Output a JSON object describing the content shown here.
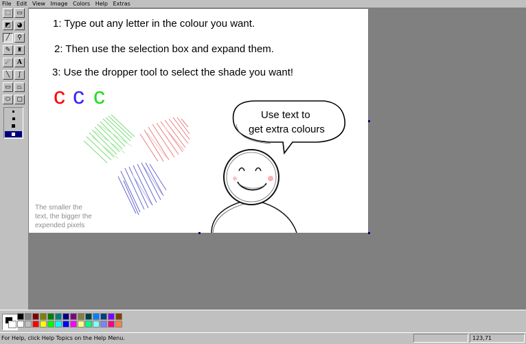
{
  "menu": [
    "File",
    "Edit",
    "View",
    "Image",
    "Colors",
    "Help",
    "Extras"
  ],
  "menu_accel": [
    "F",
    "E",
    "V",
    "I",
    "C",
    "H",
    "x"
  ],
  "tools": [
    {
      "name": "free-select-tool",
      "glyph": "⬚"
    },
    {
      "name": "select-tool",
      "glyph": "▭"
    },
    {
      "name": "eraser-tool",
      "glyph": "◩"
    },
    {
      "name": "fill-tool",
      "glyph": "◕"
    },
    {
      "name": "color-picker-tool",
      "glyph": "╱"
    },
    {
      "name": "magnifier-tool",
      "glyph": "⚲"
    },
    {
      "name": "pencil-tool",
      "glyph": "✎"
    },
    {
      "name": "brush-tool",
      "glyph": "♜"
    },
    {
      "name": "airbrush-tool",
      "glyph": "☄"
    },
    {
      "name": "text-tool",
      "glyph": "A"
    },
    {
      "name": "line-tool",
      "glyph": "╲"
    },
    {
      "name": "curve-tool",
      "glyph": "∫"
    },
    {
      "name": "rectangle-tool",
      "glyph": "▭"
    },
    {
      "name": "polygon-tool",
      "glyph": "⏢"
    },
    {
      "name": "ellipse-tool",
      "glyph": "⬭"
    },
    {
      "name": "rounded-rect-tool",
      "glyph": "▢"
    }
  ],
  "canvas": {
    "line1": "1: Type out any letter in the colour you want.",
    "line2": "2: Then use the selection box and expand them.",
    "line3": "3: Use the dropper tool to select the shade you want!",
    "letters": [
      {
        "char": "c",
        "color": "#ff0000"
      },
      {
        "char": "c",
        "color": "#0000ff"
      },
      {
        "char": "c",
        "color": "#00cc00"
      }
    ],
    "note_line1": "The smaller the",
    "note_line2": "text, the bigger the",
    "note_line3": "expended pixels",
    "bubble_line1": "Use text to",
    "bubble_line2": "get extra colours"
  },
  "palette": {
    "row1": [
      "#000000",
      "#808080",
      "#800000",
      "#808000",
      "#008000",
      "#008080",
      "#000080",
      "#800080",
      "#808040",
      "#004040",
      "#0080ff",
      "#004080",
      "#8000ff",
      "#804000"
    ],
    "row2": [
      "#ffffff",
      "#c0c0c0",
      "#ff0000",
      "#ffff00",
      "#00ff00",
      "#00ffff",
      "#0000ff",
      "#ff00ff",
      "#ffff80",
      "#00ff80",
      "#80ffff",
      "#8080ff",
      "#ff0080",
      "#ff8040"
    ]
  },
  "status": {
    "help_text": "For Help, click Help Topics on the Help Menu.",
    "coords": "123,71"
  }
}
